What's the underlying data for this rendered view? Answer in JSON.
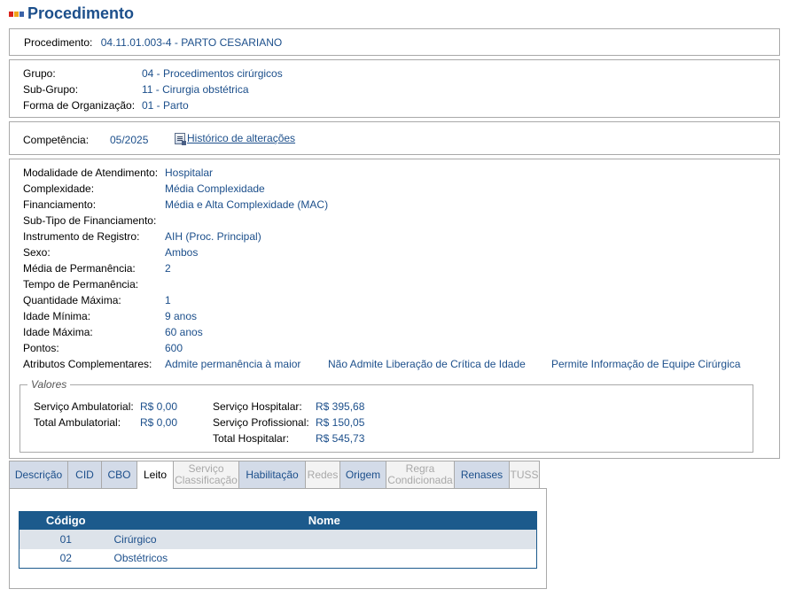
{
  "page": {
    "title": "Procedimento",
    "icon_colors": [
      "#d9231c",
      "#f0a41a",
      "#3b63a8"
    ]
  },
  "procedure": {
    "label": "Procedimento:",
    "value": "04.11.01.003-4 - PARTO CESARIANO"
  },
  "classification": {
    "group_label": "Grupo:",
    "group_value": "04 - Procedimentos cirúrgicos",
    "subgroup_label": "Sub-Grupo:",
    "subgroup_value": "11 - Cirurgia obstétrica",
    "org_label": "Forma de Organização:",
    "org_value": "01 - Parto"
  },
  "competence": {
    "label": "Competência:",
    "value": "05/2025",
    "history_link": "Histórico de alterações"
  },
  "details": {
    "modalidade_label": "Modalidade de Atendimento:",
    "modalidade_value": "Hospitalar",
    "complexidade_label": "Complexidade:",
    "complexidade_value": "Média Complexidade",
    "financiamento_label": "Financiamento:",
    "financiamento_value": "Média e Alta Complexidade (MAC)",
    "subtipo_label": "Sub-Tipo de Financiamento:",
    "subtipo_value": "",
    "instrumento_label": "Instrumento de Registro:",
    "instrumento_value": "AIH (Proc. Principal)",
    "sexo_label": "Sexo:",
    "sexo_value": "Ambos",
    "media_perm_label": "Média de Permanência:",
    "media_perm_value": "2",
    "tempo_perm_label": "Tempo de Permanência:",
    "tempo_perm_value": "",
    "qtd_max_label": "Quantidade Máxima:",
    "qtd_max_value": "1",
    "idade_min_label": "Idade Mínima:",
    "idade_min_value": "9 anos",
    "idade_max_label": "Idade Máxima:",
    "idade_max_value": "60 anos",
    "pontos_label": "Pontos:",
    "pontos_value": "600",
    "atributos_label": "Atributos Complementares:",
    "atributos": [
      "Admite permanência à maior",
      "Não Admite Liberação de Crítica de Idade",
      "Permite Informação de Equipe Cirúrgica"
    ]
  },
  "valores": {
    "legend": "Valores",
    "serv_amb_label": "Serviço Ambulatorial:",
    "serv_amb_value": "R$ 0,00",
    "total_amb_label": "Total Ambulatorial:",
    "total_amb_value": "R$ 0,00",
    "serv_hosp_label": "Serviço Hospitalar:",
    "serv_hosp_value": "R$ 395,68",
    "serv_prof_label": "Serviço Profissional:",
    "serv_prof_value": "R$ 150,05",
    "total_hosp_label": "Total Hospitalar:",
    "total_hosp_value": "R$ 545,73"
  },
  "tabs": {
    "descricao": "Descrição",
    "cid": "CID",
    "cbo": "CBO",
    "leito": "Leito",
    "servico_1": "Serviço",
    "servico_2": "Classificação",
    "habilitacao": "Habilitação",
    "redes": "Redes",
    "origem": "Origem",
    "regra_1": "Regra",
    "regra_2": "Condicionada",
    "renases": "Renases",
    "tuss": "TUSS"
  },
  "leito_table": {
    "col_codigo": "Código",
    "col_nome": "Nome",
    "rows": [
      {
        "codigo": "01",
        "nome": "Cirúrgico"
      },
      {
        "codigo": "02",
        "nome": "Obstétricos"
      }
    ]
  }
}
